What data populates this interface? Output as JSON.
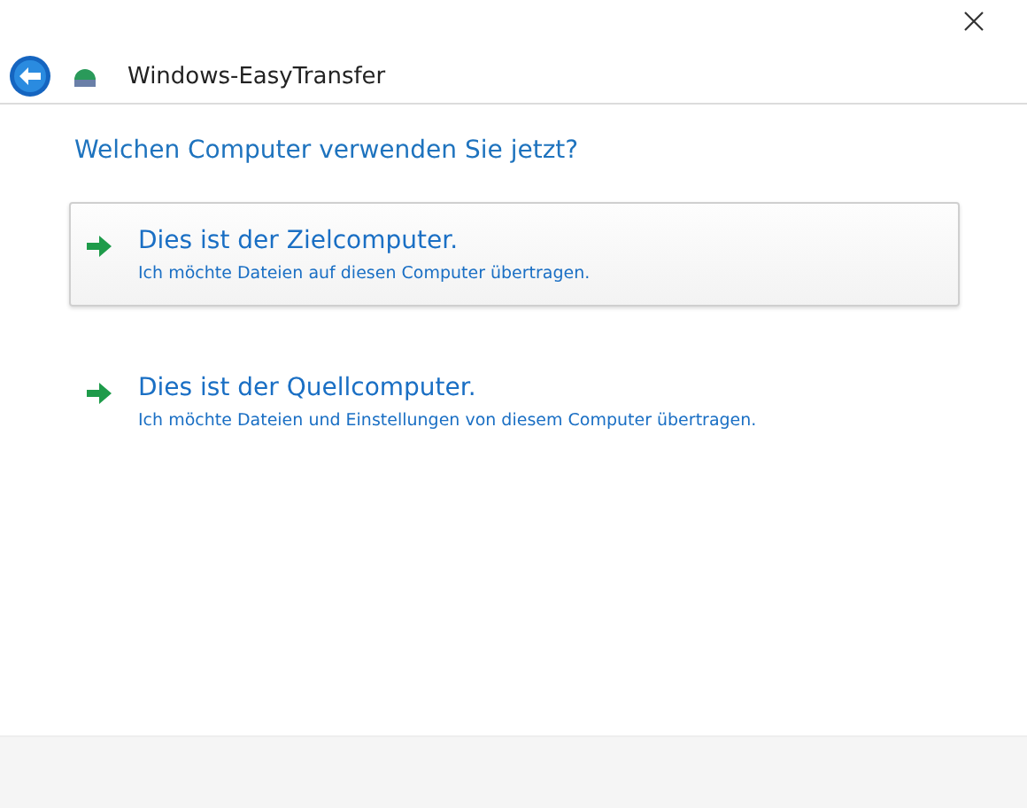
{
  "window": {
    "title": "Windows-EasyTransfer"
  },
  "heading": "Welchen Computer verwenden Sie jetzt?",
  "options": [
    {
      "title": "Dies ist der Zielcomputer.",
      "description": "Ich möchte Dateien auf diesen Computer übertragen.",
      "selected": true
    },
    {
      "title": "Dies ist der Quellcomputer.",
      "description": "Ich möchte Dateien und Einstellungen von diesem Computer übertragen.",
      "selected": false
    }
  ]
}
